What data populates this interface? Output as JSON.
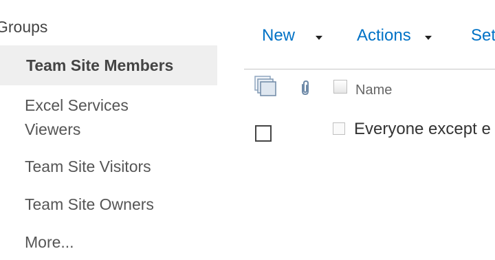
{
  "nav": {
    "heading": "Groups",
    "items": [
      {
        "label": "Team Site Members",
        "selected": true
      },
      {
        "label": "Excel Services Viewers",
        "selected": false
      },
      {
        "label": "Team Site Visitors",
        "selected": false
      },
      {
        "label": "Team Site Owners",
        "selected": false
      },
      {
        "label": "More...",
        "selected": false
      }
    ]
  },
  "toolbar": {
    "new_label": "New",
    "actions_label": "Actions",
    "settings_label": "Set"
  },
  "list": {
    "columns": {
      "name": "Name"
    },
    "rows": [
      {
        "name": "Everyone except e"
      }
    ]
  },
  "colors": {
    "accent": "#0072c6",
    "selected_bg": "#efefef",
    "divider": "#c6c6c6"
  }
}
